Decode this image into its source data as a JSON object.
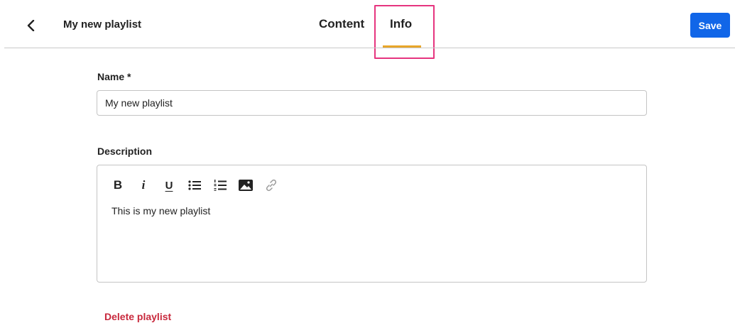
{
  "header": {
    "title": "My new playlist",
    "back_icon": "chevron-left-icon",
    "tabs": [
      {
        "label": "Content",
        "active": false
      },
      {
        "label": "Info",
        "active": true
      }
    ],
    "save_label": "Save",
    "accent_color": "#e8a62a",
    "save_color": "#1166e8",
    "highlight_color": "#e6357f"
  },
  "form": {
    "name_label": "Name *",
    "name_value": "My new playlist",
    "description_label": "Description",
    "toolbar": [
      {
        "icon": "bold-icon",
        "glyph": "B"
      },
      {
        "icon": "italic-icon",
        "glyph": "i"
      },
      {
        "icon": "underline-icon",
        "glyph": "U"
      },
      {
        "icon": "bulleted-list-icon"
      },
      {
        "icon": "numbered-list-icon"
      },
      {
        "icon": "image-icon"
      },
      {
        "icon": "link-icon"
      }
    ],
    "description_value": "This is my new playlist",
    "delete_label": "Delete playlist",
    "delete_color": "#c8283c"
  }
}
